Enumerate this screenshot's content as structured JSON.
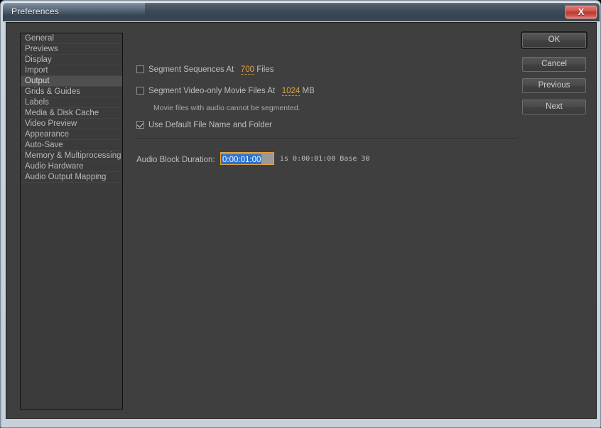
{
  "window": {
    "title": "Preferences",
    "close_icon": "close-icon",
    "close_label": "X"
  },
  "sidebar": {
    "items": [
      {
        "label": "General",
        "selected": false
      },
      {
        "label": "Previews",
        "selected": false
      },
      {
        "label": "Display",
        "selected": false
      },
      {
        "label": "Import",
        "selected": false
      },
      {
        "label": "Output",
        "selected": true
      },
      {
        "label": "Grids & Guides",
        "selected": false
      },
      {
        "label": "Labels",
        "selected": false
      },
      {
        "label": "Media & Disk Cache",
        "selected": false
      },
      {
        "label": "Video Preview",
        "selected": false
      },
      {
        "label": "Appearance",
        "selected": false
      },
      {
        "label": "Auto-Save",
        "selected": false
      },
      {
        "label": "Memory & Multiprocessing",
        "selected": false
      },
      {
        "label": "Audio Hardware",
        "selected": false
      },
      {
        "label": "Audio Output Mapping",
        "selected": false
      }
    ]
  },
  "main": {
    "segment_sequences": {
      "checked": false,
      "label": "Segment Sequences At",
      "value": "700",
      "unit": "Files"
    },
    "segment_video_only": {
      "checked": false,
      "label": "Segment Video-only Movie Files At",
      "value": "1024",
      "unit": "MB"
    },
    "segment_note": "Movie files with audio cannot be segmented.",
    "use_default_file_name": {
      "checked": true,
      "label": "Use Default File Name and Folder"
    },
    "audio_block_duration": {
      "label": "Audio Block Duration:",
      "value": "0:00:01:00",
      "suffix": "is 0:00:01:00  Base 30"
    }
  },
  "buttons": {
    "ok": "OK",
    "cancel": "Cancel",
    "previous": "Previous",
    "next": "Next"
  },
  "colors": {
    "accent_orange": "#e0a33c",
    "selection_blue": "#2a72d4",
    "panel_bg": "#3f3f3f",
    "titlebar": "#3c4a58",
    "close_red": "#c9514a"
  }
}
